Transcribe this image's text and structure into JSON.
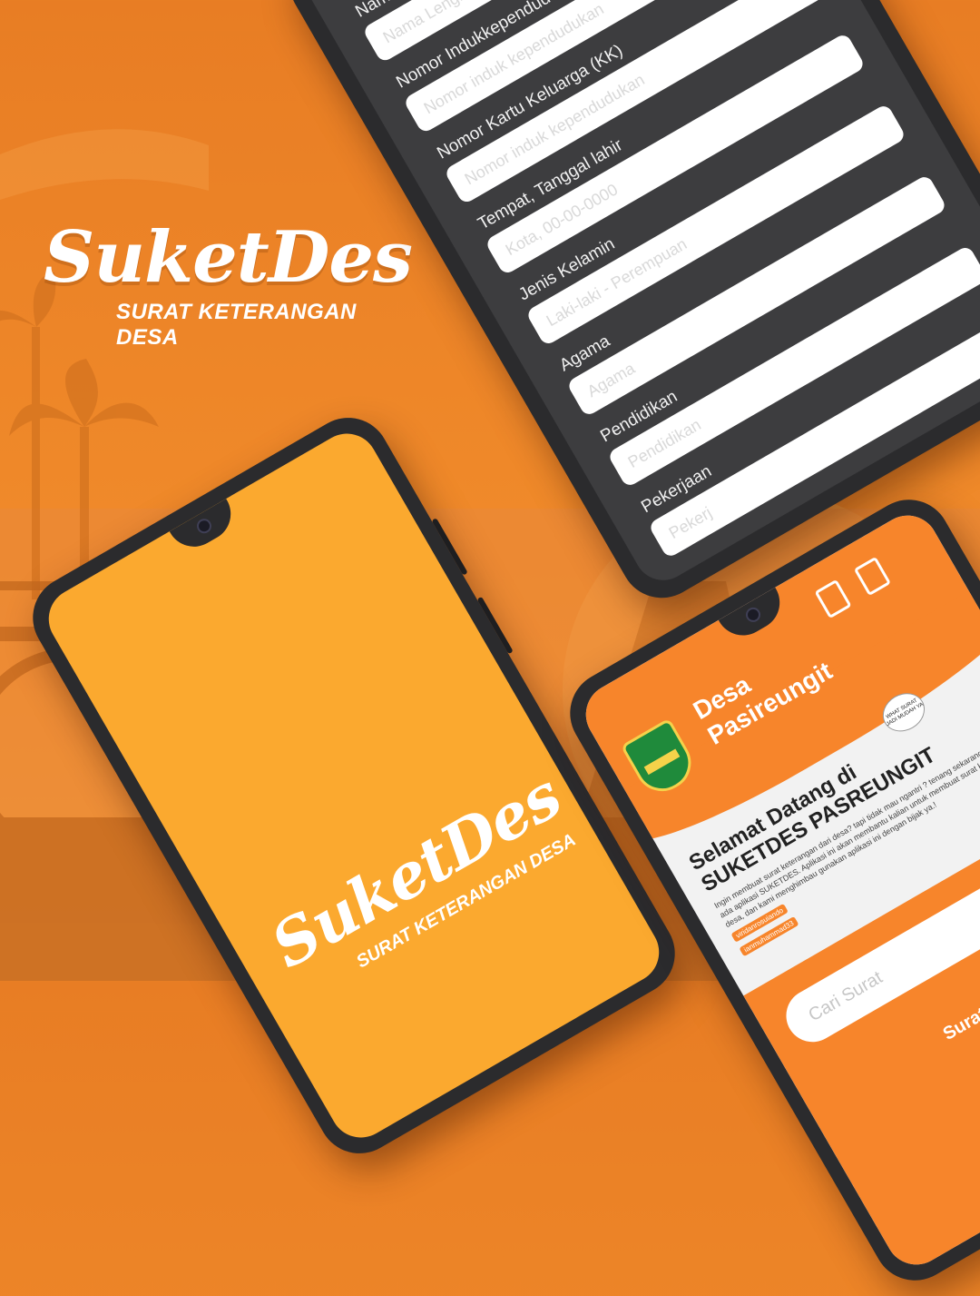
{
  "brand": {
    "title": "SuketDes",
    "subtitle": "SURAT KETERANGAN DESA"
  },
  "form": {
    "fields": [
      {
        "label": "Nama",
        "placeholder": "Nama Lengkap"
      },
      {
        "label": "Nomor Indukkependudukan",
        "placeholder": "Nomor induk kependudukan"
      },
      {
        "label": "Nomor Kartu Keluarga (KK)",
        "placeholder": "Nomor induk kependudukan"
      },
      {
        "label": "Tempat, Tanggal lahir",
        "placeholder": "Kota, 00-00-0000"
      },
      {
        "label": "Jenis Kelamin",
        "placeholder": "Laki-laki - Perempuan"
      },
      {
        "label": "Agama",
        "placeholder": "Agama"
      },
      {
        "label": "Pendidikan",
        "placeholder": "Pendidikan"
      },
      {
        "label": "Pekerjaan",
        "placeholder": "Pekerj"
      }
    ]
  },
  "splash": {
    "title": "SuketDes",
    "subtitle": "SURAT KETERANGAN DESA"
  },
  "home": {
    "village_line1": "Desa",
    "village_line2": "Pasireungit",
    "welcome_title_line1": "Selamat Datang di",
    "welcome_title_line2": "SUKETDES PASREUNGIT",
    "welcome_body": "Ingin membuat surat keterangan dari desa? tapi tidak mau ngantri ? tenang sekarang sudah ada aplikasi SUKETDES. Aplikasi ini akan membantu kalian untuk membuat surat keterangan desa, dan kami menghimbau gunakan aplikasi ini dengan bijak ya.!",
    "social_1": "viridanrosuiando",
    "social_2": "ianmuhammad33",
    "speech_text": "WHAT SURAT JADI MUDAH YA",
    "search_placeholder": "Cari Surat",
    "letters_label": "Surat K"
  },
  "colors": {
    "orange": "#f7852b",
    "splash_bg": "#fba92f",
    "form_bg": "#3d3d3f",
    "emblem": "#1f8a3b"
  }
}
